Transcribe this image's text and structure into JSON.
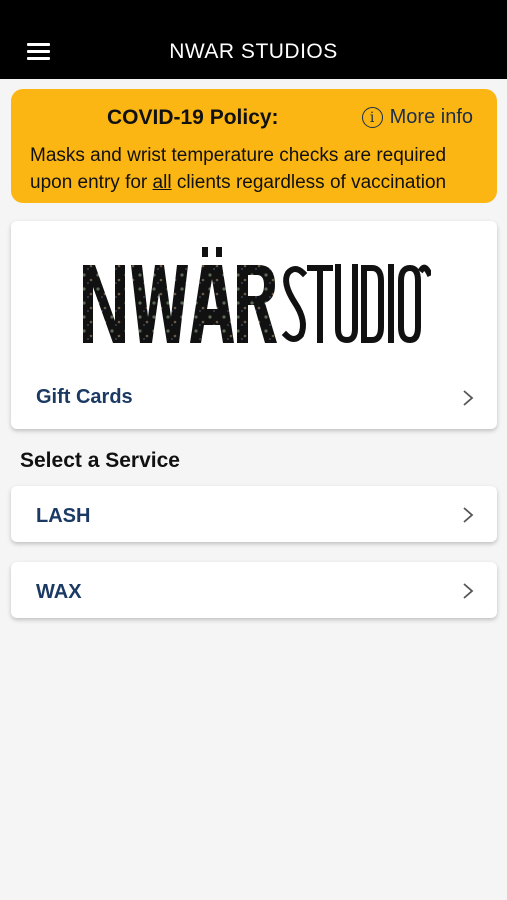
{
  "header": {
    "title": "NWAR STUDIOS"
  },
  "covid": {
    "title": "COVID-19 Policy:",
    "more_info": "More info",
    "line1": "Masks and wrist temperature checks are required",
    "line2_pre": "upon entry for ",
    "line2_em": "all",
    "line2_post": " clients regardless of vaccination"
  },
  "logo": {
    "brand_wordmark": "NWÄRSTUDIOS"
  },
  "gift_cards_label": "Gift Cards",
  "section_title": "Select a Service",
  "services": [
    {
      "label": "LASH"
    },
    {
      "label": "WAX"
    }
  ],
  "colors": {
    "banner": "#fcb614",
    "accent": "#1b3a63",
    "topbar": "#000000"
  }
}
